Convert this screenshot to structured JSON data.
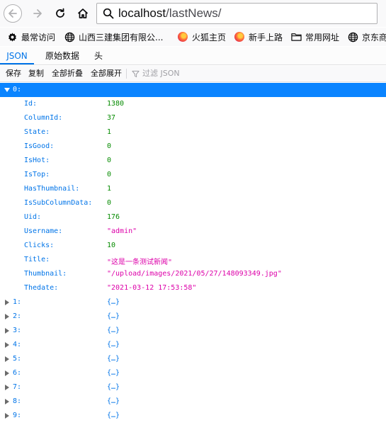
{
  "browser": {
    "url_host": "localhost",
    "url_path": "/lastNews/"
  },
  "bookmarks": [
    {
      "label": "最常访问",
      "icon": "gear-icon"
    },
    {
      "label": "山西三建集团有限公...",
      "icon": "globe-icon"
    },
    {
      "label": "火狐主页",
      "icon": "firefox-icon"
    },
    {
      "label": "新手上路",
      "icon": "firefox-icon"
    },
    {
      "label": "常用网址",
      "icon": "folder-icon"
    },
    {
      "label": "京东商",
      "icon": "globe-icon"
    }
  ],
  "tabs": [
    "JSON",
    "原始数据",
    "头"
  ],
  "toolbar": {
    "save": "保存",
    "copy": "复制",
    "collapse_all": "全部折叠",
    "expand_all": "全部展开",
    "filter_placeholder": "过滤 JSON"
  },
  "json": {
    "root_key": "0:",
    "fields": [
      {
        "key": "Id:",
        "value": "1380",
        "type": "num"
      },
      {
        "key": "ColumnId:",
        "value": "37",
        "type": "num"
      },
      {
        "key": "State:",
        "value": "1",
        "type": "num"
      },
      {
        "key": "IsGood:",
        "value": "0",
        "type": "num"
      },
      {
        "key": "IsHot:",
        "value": "0",
        "type": "num"
      },
      {
        "key": "IsTop:",
        "value": "0",
        "type": "num"
      },
      {
        "key": "HasThumbnail:",
        "value": "1",
        "type": "num"
      },
      {
        "key": "IsSubColumnData:",
        "value": "0",
        "type": "num"
      },
      {
        "key": "Uid:",
        "value": "176",
        "type": "num"
      },
      {
        "key": "Username:",
        "value": "\"admin\"",
        "type": "str"
      },
      {
        "key": "Clicks:",
        "value": "10",
        "type": "num"
      },
      {
        "key": "Title:",
        "value": "\"这是一条测试新闻\"",
        "type": "str"
      },
      {
        "key": "Thumbnail:",
        "value": "\"/upload/images/2021/05/27/148093349.jpg\"",
        "type": "str"
      },
      {
        "key": "Thedate:",
        "value": "\"2021-03-12 17:53:58\"",
        "type": "str"
      }
    ],
    "collapsed": [
      {
        "key": "1:",
        "value": "{…}"
      },
      {
        "key": "2:",
        "value": "{…}"
      },
      {
        "key": "3:",
        "value": "{…}"
      },
      {
        "key": "4:",
        "value": "{…}"
      },
      {
        "key": "5:",
        "value": "{…}"
      },
      {
        "key": "6:",
        "value": "{…}"
      },
      {
        "key": "7:",
        "value": "{…}"
      },
      {
        "key": "8:",
        "value": "{…}"
      },
      {
        "key": "9:",
        "value": "{…}"
      }
    ]
  }
}
